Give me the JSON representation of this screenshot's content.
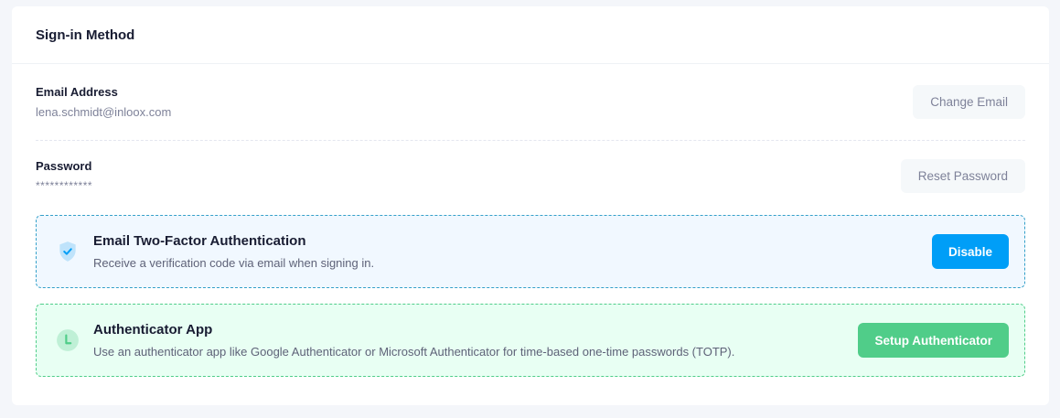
{
  "card": {
    "title": "Sign-in Method"
  },
  "email": {
    "label": "Email Address",
    "value": "lena.schmidt@inloox.com",
    "button": "Change Email"
  },
  "password": {
    "label": "Password",
    "value": "************",
    "button": "Reset Password"
  },
  "two_factor": {
    "icon": "shield-check-icon",
    "title": "Email Two-Factor Authentication",
    "description": "Receive a verification code via email when signing in.",
    "button": "Disable",
    "accent": "#009ef7"
  },
  "authenticator": {
    "icon": "clock-icon",
    "title": "Authenticator App",
    "description": "Use an authenticator app like Google Authenticator or Microsoft Authenticator for time-based one-time passwords (TOTP).",
    "button": "Setup Authenticator",
    "accent": "#50cd89"
  }
}
